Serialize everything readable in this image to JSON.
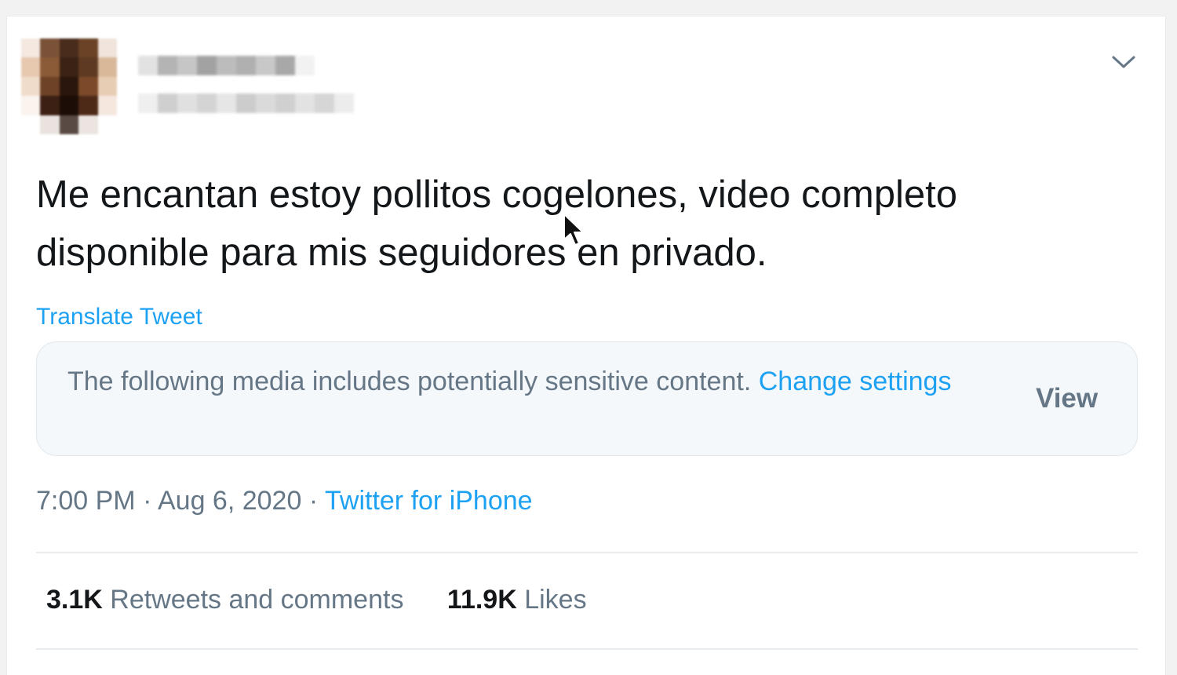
{
  "tweet": {
    "text": "Me encantan estoy pollitos cogelones, video completo disponible para mis seguidores en privado.",
    "translate_label": "Translate Tweet",
    "sensitive_notice": {
      "message": "The following media includes potentially sensitive content.",
      "change_link": "Change settings",
      "view_label": "View"
    },
    "time": "7:00 PM",
    "date": "Aug 6, 2020",
    "separator": "·",
    "source": "Twitter for iPhone",
    "stats": {
      "retweets_count": "3.1K",
      "retweets_label": "Retweets and comments",
      "likes_count": "11.9K",
      "likes_label": "Likes"
    }
  },
  "colors": {
    "link": "#1da1f2",
    "secondary_text": "#657786",
    "primary_text": "#14171a",
    "notice_background": "#f5f8fa"
  },
  "icons": {
    "menu": "chevron-down-icon",
    "cursor": "mouse-pointer-icon"
  }
}
